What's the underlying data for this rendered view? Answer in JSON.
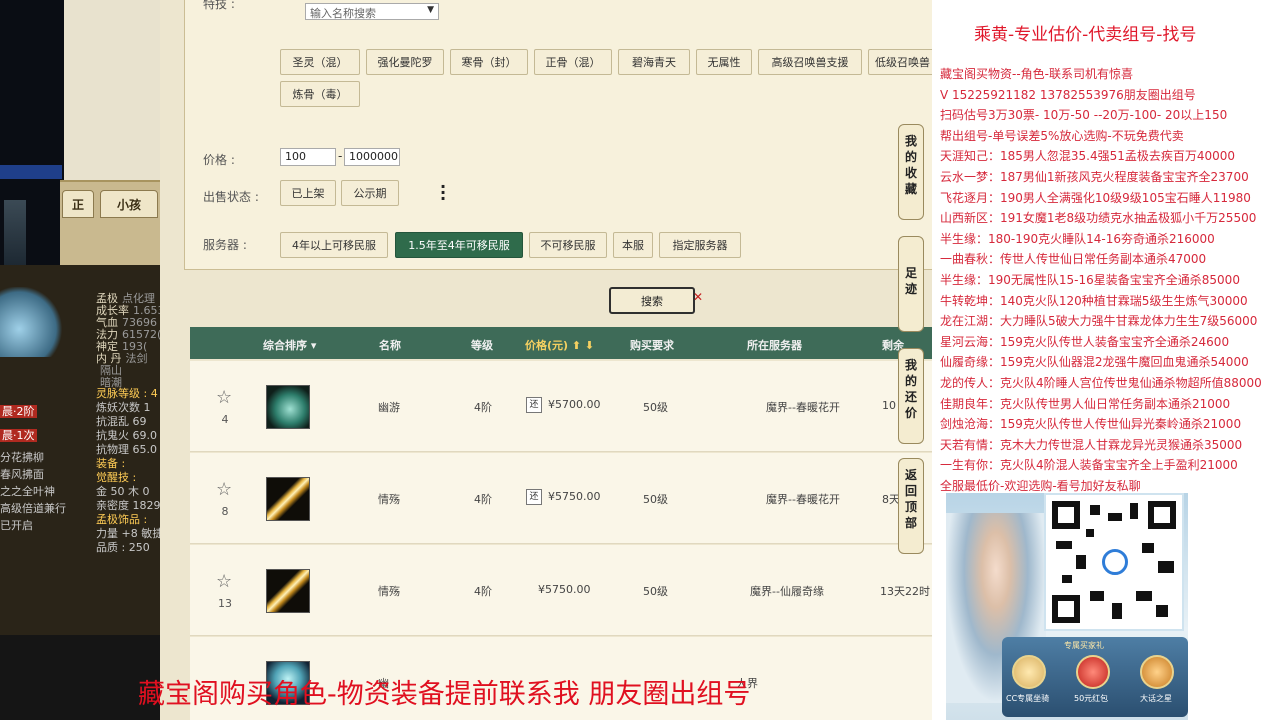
{
  "left_game": {
    "tabs": [
      "正",
      "小孩"
    ],
    "pet_stats": [
      {
        "k": "孟极",
        "v": "点化理"
      },
      {
        "k": "成长率",
        "v": "1.653"
      },
      {
        "k": "气血",
        "v": "73696"
      },
      {
        "k": "法力",
        "v": "61572("
      },
      {
        "k": "神定",
        "v": "193("
      },
      {
        "k": "内 丹",
        "v": "法剑"
      },
      {
        "k": "",
        "v": "隔山"
      },
      {
        "k": "",
        "v": "暗潮"
      }
    ],
    "lower_stats": [
      {
        "text": "灵脉等级 : 4",
        "cls": "orange"
      },
      {
        "text": "炼妖次数 1",
        "cls": ""
      },
      {
        "text": "抗混乱 69",
        "cls": ""
      },
      {
        "text": "抗鬼火 69.0",
        "cls": ""
      },
      {
        "text": "抗物理 65.0",
        "cls": ""
      },
      {
        "text": "装备 :",
        "cls": "orange"
      },
      {
        "text": "觉醒技 : ",
        "cls": "orange"
      },
      {
        "text": "金 50 木 0",
        "cls": ""
      },
      {
        "text": "亲密度 1829",
        "cls": ""
      },
      {
        "text": "孟极饰品 :",
        "cls": "orange"
      },
      {
        "text": "力量 +8 敏捷",
        "cls": ""
      },
      {
        "text": "品质 : 250",
        "cls": ""
      }
    ],
    "left_tags": [
      "晨·2阶",
      "晨·1次"
    ],
    "left_skills": [
      "分花拂柳",
      "春风拂面",
      "之之全叶神",
      "高级倍道兼行",
      "已开启"
    ]
  },
  "filters": {
    "skills_label": "特技 :",
    "name_placeholder": "输入名称搜索",
    "skill_buttons": [
      "圣灵（混）",
      "强化曼陀罗",
      "寒骨（封）",
      "正骨（混）",
      "碧海青天",
      "无属性",
      "高级召唤兽支援",
      "低级召唤兽",
      "炼骨（毒）"
    ],
    "price_label": "价格 :",
    "price_min": "100",
    "price_max": "1000000",
    "sale_label": "出售状态 :",
    "sale_buttons": [
      "已上架",
      "公示期"
    ],
    "server_label": "服务器 :",
    "server_buttons": [
      "4年以上可移民服",
      "1.5年至4年可移民服",
      "不可移民服",
      "本服",
      "指定服务器"
    ],
    "search_label": "搜索"
  },
  "table": {
    "headers": [
      "综合排序 ▾",
      "名称",
      "等级",
      "价格(元) ⬆ ⬇",
      "购买要求",
      "所在服务器",
      "剩余"
    ],
    "rows": [
      {
        "count": "4",
        "name": "幽游",
        "level": "4阶",
        "price": "¥5700.00",
        "huan": "还",
        "req": "50级",
        "server": "魔界--春暖花开",
        "time": "10"
      },
      {
        "count": "8",
        "name": "情殇",
        "level": "4阶",
        "price": "¥5750.00",
        "huan": "还",
        "req": "50级",
        "server": "魔界--春暖花开",
        "time": "8天"
      },
      {
        "count": "13",
        "name": "情殇",
        "level": "4阶",
        "price": "¥5750.00",
        "huan": "",
        "req": "50级",
        "server": "魔界--仙履奇缘",
        "time": "13天22时"
      },
      {
        "count": "",
        "name": "幽",
        "level": "",
        "price": "",
        "huan": "",
        "req": "",
        "server": "人界",
        "time": ""
      }
    ]
  },
  "side_tabs": [
    "我的收藏",
    "足迹",
    "我的还价",
    "返回顶部"
  ],
  "right_panel": {
    "title": "乘黄-专业估价-代卖组号-找号",
    "lines": [
      "藏宝阁买物资--角色-联系司机有惊喜",
      "V 15225921182  13782553976朋友圈出组号",
      "扫码估号3万30票- 10万-50 --20万-100- 20以上150",
      "帮出组号-单号误差5%放心选购-不玩免费代卖",
      "天涯知己：185男人忽混35.4强51孟极去疾百万40000",
      "云水一梦：187男仙1新孩风克火程度装备宝宝齐全23700",
      "飞花逐月：190男人全满强化10级9级105宝石睡人11980",
      "山西新区：191女魔1老8级功绩克水抽孟极狐小千万25500",
      "半生缘：180-190克火睡队14-16夯奇通杀216000",
      "一曲春秋：传世人传世仙日常任务副本通杀47000",
      "半生缘：190无属性队15-16星装备宝宝齐全通杀85000",
      "牛转乾坤：140克火队120种植甘霖瑞5级生生炼气30000",
      "龙在江湖：大力睡队5破大力强牛甘霖龙体力生生7级56000",
      "星河云海：159克火队传世人装备宝宝齐全通杀24600",
      "仙履奇缘：159克火队仙器混2龙强牛魔回血鬼通杀54000",
      "龙的传人：克火队4阶睡人宫位传世鬼仙通杀物超所值88000",
      "佳期良年：克火队传世男人仙日常任务副本通杀21000",
      "剑烛沧海：159克火队传世人传世仙异光秦岭通杀21000",
      "天若有情：克木大力传世混人甘霖龙异光灵猴通杀35000",
      "一生有你：克火队4阶混人装备宝宝齐全上手盈利21000",
      "全服最低价-欢迎选购-看号加好友私聊"
    ],
    "promo_header": "专属买家礼",
    "promo_items": [
      "CC专属坐骑",
      "50元红包",
      "大话之星"
    ]
  },
  "bottom_banner": "藏宝阁购买角色-物资装备提前联系我     朋友圈出组号"
}
